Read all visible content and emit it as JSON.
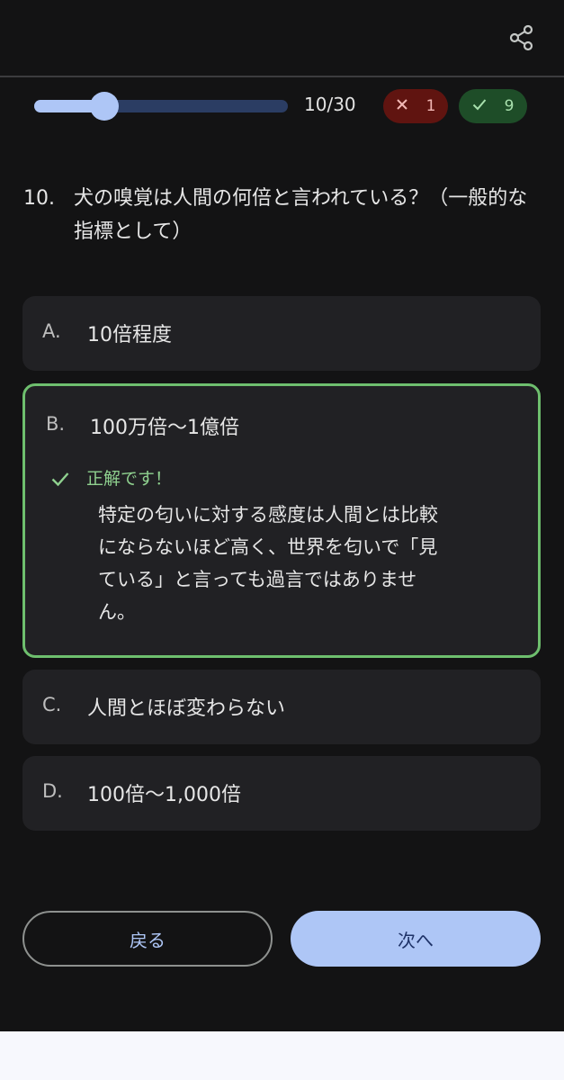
{
  "header": {
    "share_icon": "share-icon"
  },
  "progress": {
    "current": 10,
    "total": 30,
    "fraction": 0.2778,
    "label": "10/30"
  },
  "score": {
    "wrong_icon": "close-icon",
    "wrong_count": "1",
    "right_icon": "check-icon",
    "right_count": "9"
  },
  "question": {
    "number": "10.",
    "text": "犬の嗅覚は人間の何倍と言われている？（一般的な指標として）"
  },
  "options": [
    {
      "letter": "A.",
      "text": "10倍程度"
    },
    {
      "letter": "B.",
      "text": "100万倍〜1億倍"
    },
    {
      "letter": "C.",
      "text": "人間とほぼ変わらない"
    },
    {
      "letter": "D.",
      "text": "100倍〜1,000倍"
    }
  ],
  "feedback": {
    "icon": "check-icon",
    "label": "正解です！",
    "explanation": "特定の匂いに対する感度は人間とは比較にならないほど高く、世界を匂いで「見ている」と言っても過言ではありません。"
  },
  "nav": {
    "back_label": "戻る",
    "next_label": "次へ"
  },
  "colors": {
    "background": "#131314",
    "accent": "#aec6f6",
    "correct": "#6ebf6e",
    "wrong_badge": "#601410",
    "right_badge": "#1e4d28"
  }
}
